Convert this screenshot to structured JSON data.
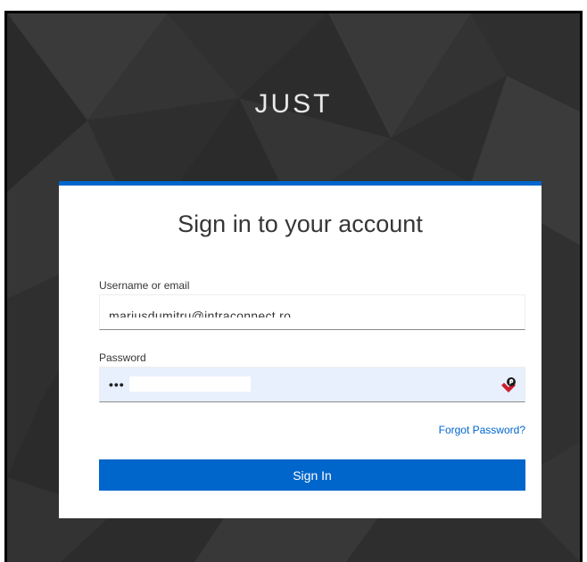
{
  "brand": {
    "title": "JUST"
  },
  "login_card": {
    "title": "Sign in to your account",
    "accent_color": "#0066cc",
    "username": {
      "label": "Username or email",
      "value": "mariusdumitru@intraconnect.ro"
    },
    "password": {
      "label": "Password",
      "masked_value": "•••"
    },
    "forgot_password_label": "Forgot Password?",
    "sign_in_label": "Sign In"
  },
  "icons": {
    "password_manager": "password-manager-icon"
  }
}
